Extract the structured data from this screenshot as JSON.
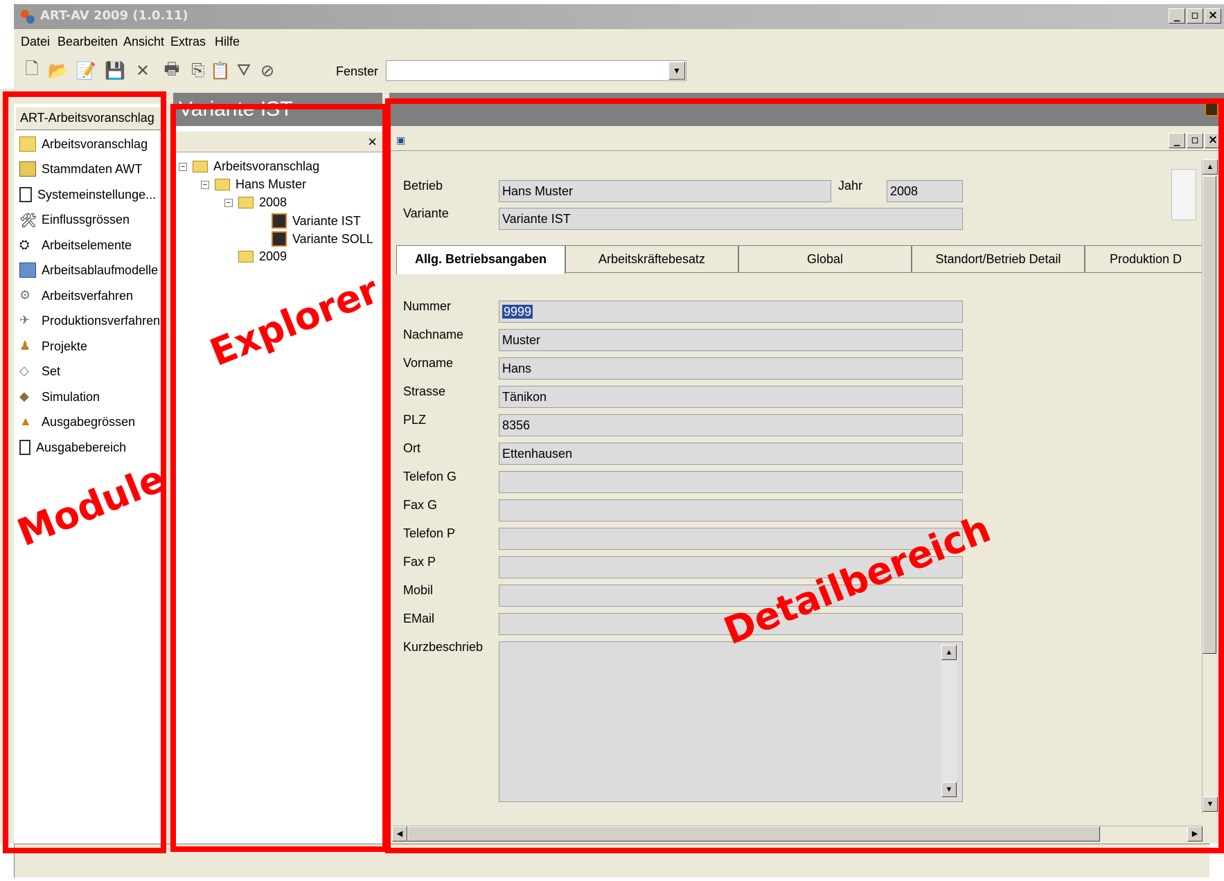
{
  "window": {
    "title": "ART-AV 2009 (1.0.11)",
    "controls": [
      "_",
      "▫",
      "×"
    ]
  },
  "menu": [
    "Datei",
    "Bearbeiten",
    "Ansicht",
    "Extras",
    "Hilfe"
  ],
  "toolbar": {
    "fenster_label": "Fenster",
    "fenster_value": "",
    "icons": [
      "new-icon",
      "open-icon",
      "notes-icon",
      "save-icon",
      "delete-icon",
      "print-icon",
      "copy-icon",
      "paste-icon",
      "filter-icon",
      "clear-filter-icon"
    ]
  },
  "modules": {
    "header": "ART-Arbeitsvoranschlag",
    "items": [
      "Arbeitsvoranschlag",
      "Stammdaten AWT",
      "Systemeinstellunge...",
      "Einflussgrössen",
      "Arbeitselemente",
      "Arbeitsablaufmodelle",
      "Arbeitsverfahren",
      "Produktionsverfahren",
      "Projekte",
      "Set",
      "Simulation",
      "Ausgabegrössen",
      "Ausgabebereich"
    ]
  },
  "explorer": {
    "title": "Variante IST",
    "close": "×",
    "tree": {
      "root": "Arbeitsvoranschlag",
      "person": "Hans Muster",
      "year1": "2008",
      "var1": "Variante IST",
      "var2": "Variante SOLL",
      "year2": "2009"
    }
  },
  "detail": {
    "betrieb_label": "Betrieb",
    "betrieb_value": "Hans Muster",
    "jahr_label": "Jahr",
    "jahr_value": "2008",
    "variante_label": "Variante",
    "variante_value": "Variante IST",
    "tabs": [
      "Allg. Betriebsangaben",
      "Arbeitskräftebesatz",
      "Global",
      "Standort/Betrieb Detail",
      "Produktion D"
    ],
    "fields": [
      {
        "label": "Nummer",
        "value": "9999"
      },
      {
        "label": "Nachname",
        "value": "Muster"
      },
      {
        "label": "Vorname",
        "value": "Hans"
      },
      {
        "label": "Strasse",
        "value": "Tänikon"
      },
      {
        "label": "PLZ",
        "value": "8356"
      },
      {
        "label": "Ort",
        "value": "Ettenhausen"
      },
      {
        "label": "Telefon G",
        "value": ""
      },
      {
        "label": "Fax G",
        "value": ""
      },
      {
        "label": "Telefon P",
        "value": ""
      },
      {
        "label": "Fax P",
        "value": ""
      },
      {
        "label": "Mobil",
        "value": ""
      },
      {
        "label": "EMail",
        "value": ""
      }
    ],
    "kurz_label": "Kurzbeschrieb",
    "kurz_value": ""
  },
  "annotations": {
    "module": "Module",
    "explorer": "Explorer",
    "detail": "Detailbereich",
    "color": "#ff0000"
  }
}
